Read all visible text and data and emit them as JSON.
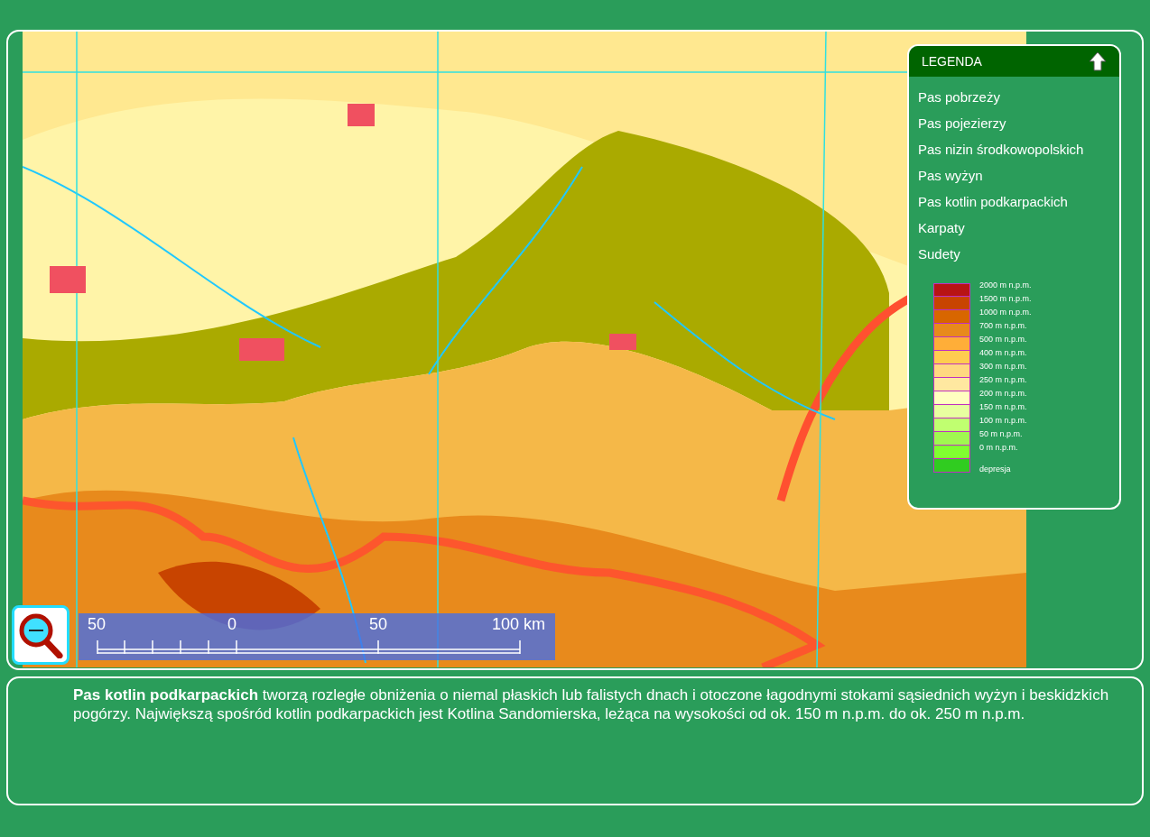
{
  "legend": {
    "title": "LEGENDA",
    "items": [
      "Pas pobrzeży",
      "Pas pojezierzy",
      "Pas nizin środkowopolskich",
      "Pas wyżyn",
      "Pas kotlin podkarpackich",
      "Karpaty",
      "Sudety"
    ],
    "scale": [
      {
        "kind": "level",
        "label": "2000 m n.p.m.",
        "color": "#b81414"
      },
      {
        "kind": "level",
        "label": "1500 m n.p.m.",
        "color": "#c84400"
      },
      {
        "kind": "level",
        "label": "1000 m n.p.m.",
        "color": "#d86600"
      },
      {
        "kind": "level",
        "label": "700 m n.p.m.",
        "color": "#e88a1c"
      },
      {
        "kind": "level",
        "label": "500 m n.p.m.",
        "color": "#ffae38"
      },
      {
        "kind": "level",
        "label": "400 m n.p.m.",
        "color": "#ffcc50"
      },
      {
        "kind": "level",
        "label": "300 m n.p.m.",
        "color": "#ffd880"
      },
      {
        "kind": "level",
        "label": "250 m n.p.m.",
        "color": "#ffe8a0"
      },
      {
        "kind": "level",
        "label": "200 m n.p.m.",
        "color": "#ffffc0"
      },
      {
        "kind": "level",
        "label": "150 m n.p.m.",
        "color": "#e8ffa0"
      },
      {
        "kind": "level",
        "label": "100 m n.p.m.",
        "color": "#c0ff70"
      },
      {
        "kind": "level",
        "label": "50 m n.p.m.",
        "color": "#a0f850"
      },
      {
        "kind": "level",
        "label": "0 m n.p.m.",
        "color": "#80ff30"
      },
      {
        "kind": "depression",
        "label": "depresja",
        "color": "#30cc20"
      }
    ]
  },
  "scale_bar": {
    "labels": [
      "50",
      "0",
      "50",
      "100 km"
    ]
  },
  "description": "**Pas kotlin podkarpackich** tworzą rozległe obniżenia o niemal płaskich lub falistych dnach i otoczone łagodnymi stokami sąsiednich wyżyn i beskidzkich pogórzy. Największą spośród kotlin podkarpackich jest Kotlina Sandomierska, leżąca na wysokości od ok. 150 m n.p.m. do ok. 250 m n.p.m."
}
